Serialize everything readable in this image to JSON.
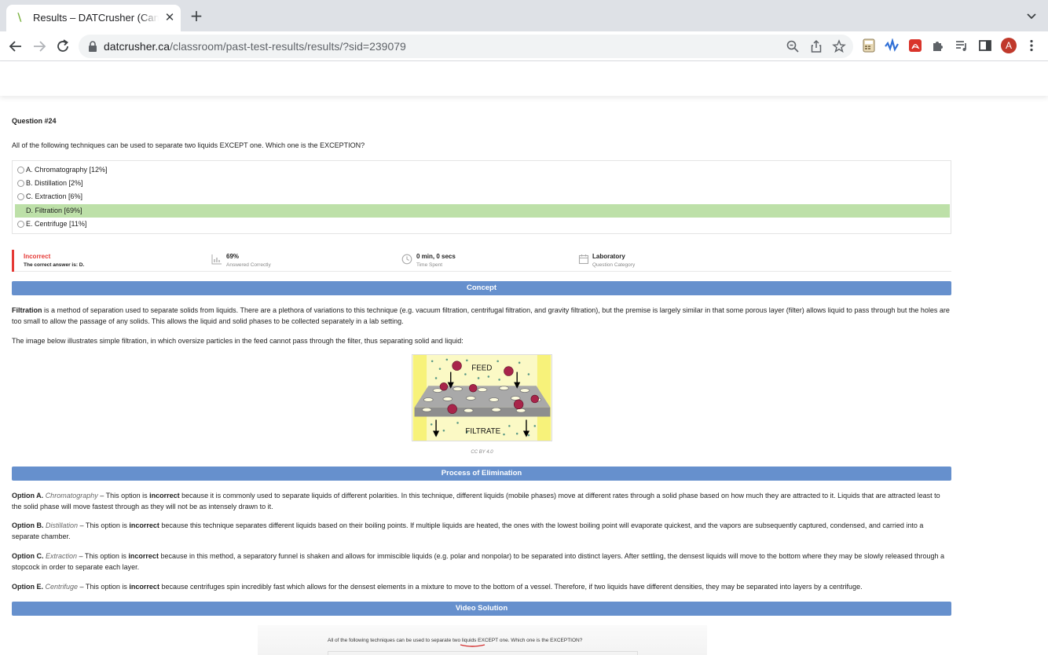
{
  "browser": {
    "tab_title": "Results – DATCrusher (Canadian DAT)",
    "url_host": "datcrusher.ca",
    "url_path": "/classroom/past-test-results/results/?sid=239079",
    "avatar_letter": "A"
  },
  "question": {
    "number": "Question #24",
    "text": "All of the following techniques can be used to separate two liquids EXCEPT one. Which one is the EXCEPTION?",
    "options": [
      {
        "label": "A. Chromatography [12%]",
        "correct": false
      },
      {
        "label": "B. Distillation [2%]",
        "correct": false
      },
      {
        "label": "C. Extraction [6%]",
        "correct": false
      },
      {
        "label": "D. Filtration [69%]",
        "correct": true
      },
      {
        "label": "E. Centrifuge [11%]",
        "correct": false
      }
    ]
  },
  "result": {
    "status": "Incorrect",
    "correct_answer": "The correct answer is: D.",
    "percent": "69%",
    "percent_label": "Answered Correctly",
    "time": "0 min, 0 secs",
    "time_label": "Time Spent",
    "category": "Laboratory",
    "category_label": "Question Category"
  },
  "sections": {
    "concept": "Concept",
    "elimination": "Process of Elimination",
    "video": "Video Solution"
  },
  "concept": {
    "term": "Filtration",
    "p1": " is a method of separation used to separate solids from liquids. There are a plethora of variations to this technique (e.g. vacuum filtration, centrifugal filtration, and gravity filtration), but the premise is largely similar in that some porous layer (filter) allows liquid to pass through but the holes are too small to allow the passage of any solids. This allows the liquid and solid phases to be collected separately in a lab setting.",
    "p2": "The image below illustrates simple filtration, in which oversize particles in the feed cannot pass through the filter, thus separating solid and liquid:",
    "diagram_feed": "FEED",
    "diagram_filtrate": "FILTRATE",
    "caption": "CC BY 4.0"
  },
  "elimination": [
    {
      "option": "Option A.",
      "name": "Chromatography",
      "pre": " – This option is ",
      "verdict": "incorrect",
      "post": " because it is commonly used to separate liquids of different polarities. In this technique, different liquids (mobile phases) move at different rates through a solid phase based on how much they are attracted to it. Liquids that are attracted least to the solid phase will move fastest through as they will not be as intensely drawn to it."
    },
    {
      "option": "Option B.",
      "name": "Distillation",
      "pre": " – This option is ",
      "verdict": "incorrect",
      "post": " because this technique separates different liquids based on their boiling points. If multiple liquids are heated, the ones with the lowest boiling point will evaporate quickest, and the vapors are subsequently captured, condensed, and carried into a separate chamber."
    },
    {
      "option": "Option C.",
      "name": "Extraction",
      "pre": " – This option is ",
      "verdict": "incorrect",
      "post": " because in this method, a separatory funnel is shaken and allows for immiscible liquids (e.g. polar and nonpolar) to be separated into distinct layers. After settling, the densest liquids will move to the bottom where they may be slowly released through a stopcock in order to separate each layer."
    },
    {
      "option": "Option E.",
      "name": "Centrifuge",
      "pre": " – This option is ",
      "verdict": "incorrect",
      "post": " because centrifuges spin incredibly fast which allows for the densest elements in a mixture to move to the bottom of a vessel. Therefore, if two liquids have different densities, they may be separated into layers by a centrifuge."
    }
  ],
  "video": {
    "preview_text": "All of the following techniques can be used to separate two liquids EXCEPT one. Which one is the EXCEPTION?"
  },
  "colors": {
    "section_bar": "#6690cd",
    "correct_highlight": "#bde0a8",
    "incorrect_red": "#e53935"
  }
}
